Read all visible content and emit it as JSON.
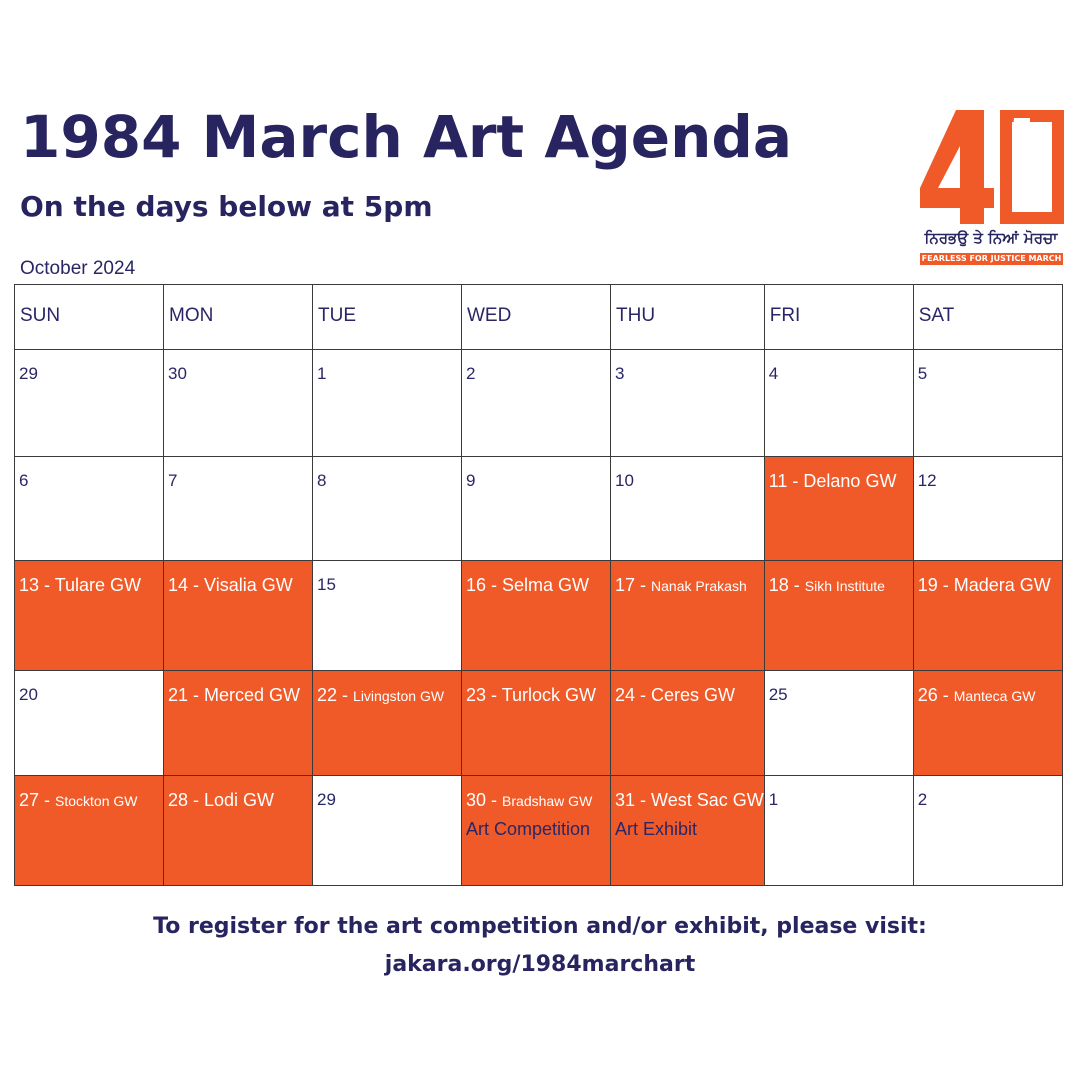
{
  "header": {
    "title": "1984 March Art Agenda",
    "subtitle": "On the days below at 5pm",
    "month_label": "October 2024"
  },
  "logo": {
    "number": "40",
    "punjabi_text": "ਨਿਰਭਉ ਤੇ ਨਿਆਂ ਮੋਰਚਾ",
    "band_text": "FEARLESS FOR JUSTICE MARCH",
    "icon": "california-map-icon"
  },
  "colors": {
    "accent_orange": "#f05a28",
    "navy": "#27245f",
    "white": "#ffffff"
  },
  "calendar": {
    "days": [
      "SUN",
      "MON",
      "TUE",
      "WED",
      "THU",
      "FRI",
      "SAT"
    ],
    "weeks": [
      [
        {
          "day": "29"
        },
        {
          "day": "30"
        },
        {
          "day": "1"
        },
        {
          "day": "2"
        },
        {
          "day": "3"
        },
        {
          "day": "4"
        },
        {
          "day": "5"
        }
      ],
      [
        {
          "day": "6"
        },
        {
          "day": "7"
        },
        {
          "day": "8"
        },
        {
          "day": "9"
        },
        {
          "day": "10"
        },
        {
          "day": "11",
          "event": " - Delano GW"
        },
        {
          "day": "12"
        }
      ],
      [
        {
          "day": "13",
          "event": " - Tulare GW"
        },
        {
          "day": "14",
          "event": " - Visalia GW"
        },
        {
          "day": "15"
        },
        {
          "day": "16",
          "event": " - Selma GW"
        },
        {
          "day": "17",
          "event": " - ",
          "event_small": "Nanak Prakash"
        },
        {
          "day": "18",
          "event": " - ",
          "event_small": "Sikh Institute"
        },
        {
          "day": "19",
          "event": " - Madera GW"
        }
      ],
      [
        {
          "day": "20"
        },
        {
          "day": "21",
          "event": " - Merced GW"
        },
        {
          "day": "22",
          "event": " - ",
          "event_small": "Livingston GW"
        },
        {
          "day": "23",
          "event": " - Turlock GW"
        },
        {
          "day": "24",
          "event": " - Ceres GW"
        },
        {
          "day": "25"
        },
        {
          "day": "26",
          "event": " - ",
          "event_small": "Manteca GW"
        }
      ],
      [
        {
          "day": "27",
          "event": " - ",
          "event_small": "Stockton GW"
        },
        {
          "day": "28",
          "event": " - Lodi GW"
        },
        {
          "day": "29"
        },
        {
          "day": "30",
          "event": " - ",
          "event_small": "Bradshaw GW",
          "note": "Art Competition"
        },
        {
          "day": "31",
          "event": " - West Sac GW",
          "note": "Art Exhibit"
        },
        {
          "day": "1"
        },
        {
          "day": "2"
        }
      ]
    ]
  },
  "footer": {
    "line1": "To register for the art competition and/or exhibit, please visit:",
    "line2": "jakara.org/1984marchart"
  }
}
